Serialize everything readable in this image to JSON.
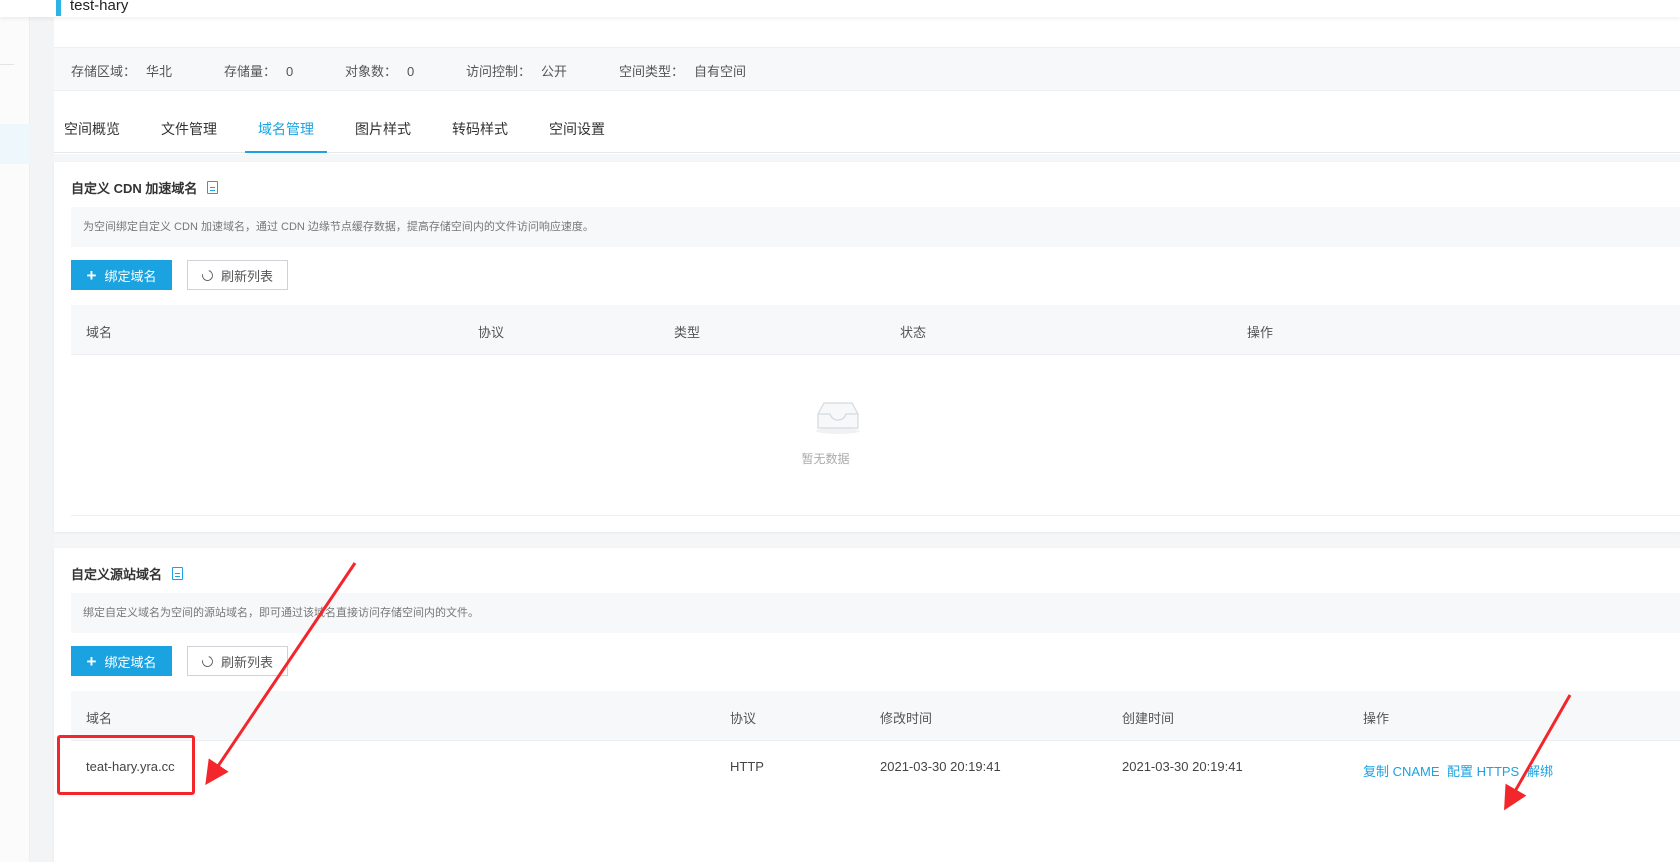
{
  "bucket": {
    "name": "test-hary"
  },
  "info": {
    "region_label": "存储区域：",
    "region_value": "华北",
    "storage_label": "存储量：",
    "storage_value": "0",
    "objects_label": "对象数：",
    "objects_value": "0",
    "access_label": "访问控制：",
    "access_value": "公开",
    "type_label": "空间类型：",
    "type_value": "自有空间"
  },
  "tabs": [
    {
      "label": "空间概览"
    },
    {
      "label": "文件管理"
    },
    {
      "label": "域名管理",
      "active": true
    },
    {
      "label": "图片样式"
    },
    {
      "label": "转码样式"
    },
    {
      "label": "空间设置"
    }
  ],
  "cdn_section": {
    "title": "自定义 CDN 加速域名",
    "description": "为空间绑定自定义 CDN 加速域名，通过 CDN 边缘节点缓存数据，提高存储空间内的文件访问响应速度。",
    "bind_button": "绑定域名",
    "refresh_button": "刷新列表",
    "columns": [
      "域名",
      "协议",
      "类型",
      "状态",
      "操作"
    ],
    "empty_text": "暂无数据"
  },
  "origin_section": {
    "title": "自定义源站域名",
    "description": "绑定自定义域名为空间的源站域名，即可通过该域名直接访问存储空间内的文件。",
    "bind_button": "绑定域名",
    "refresh_button": "刷新列表",
    "columns": [
      "域名",
      "协议",
      "修改时间",
      "创建时间",
      "操作"
    ],
    "rows": [
      {
        "domain": "teat-hary.yra.cc",
        "protocol": "HTTP",
        "modified": "2021-03-30 20:19:41",
        "created": "2021-03-30 20:19:41",
        "actions": [
          "复制 CNAME",
          "配置 HTTPS",
          "解绑"
        ]
      }
    ]
  },
  "colors": {
    "accent": "#1aa3e0",
    "annotation": "#f2262b"
  },
  "icons": [
    "document-icon",
    "plus-icon",
    "refresh-icon",
    "empty-inbox-icon"
  ]
}
